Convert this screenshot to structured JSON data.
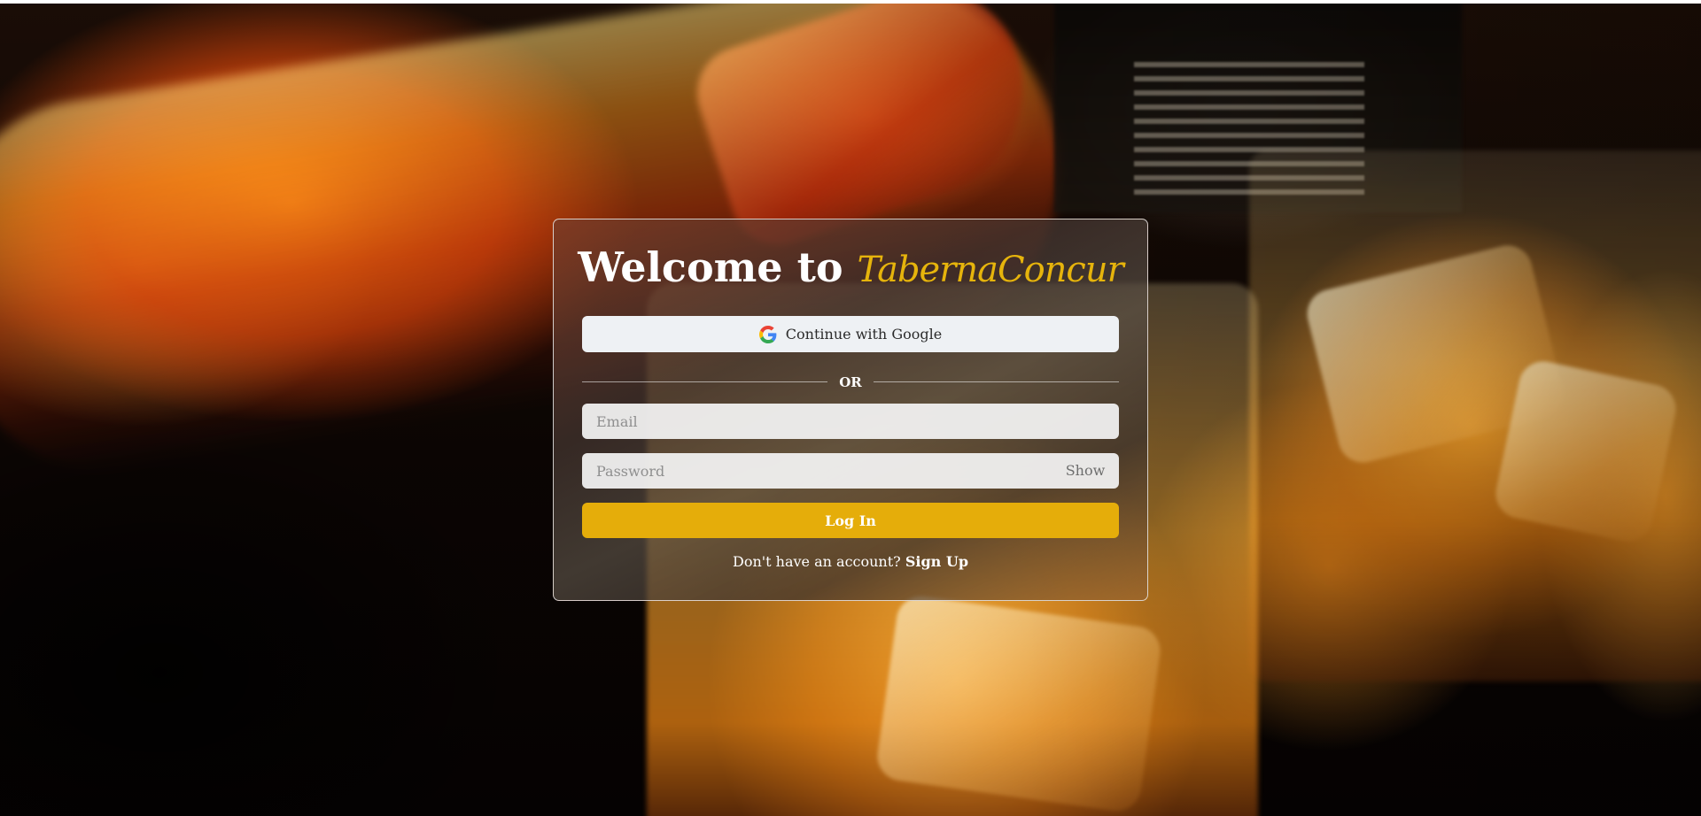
{
  "background": {
    "description_icon": "whiskey-pour-photo"
  },
  "login": {
    "title_prefix": "Welcome to",
    "brand_name": "TabernaConcur",
    "google_button_label": "Continue with Google",
    "divider_label": "OR",
    "email_placeholder": "Email",
    "password_placeholder": "Password",
    "show_toggle_label": "Show",
    "login_button_label": "Log In",
    "signup_prompt": "Don't have an account?",
    "signup_link_label": "Sign Up"
  },
  "colors": {
    "accent": "#e5ad0a",
    "brand": "#e6b40c",
    "google_button_bg": "#eef1f4",
    "input_bg": "#f4f4f4"
  },
  "icons": {
    "google": "google-icon"
  }
}
